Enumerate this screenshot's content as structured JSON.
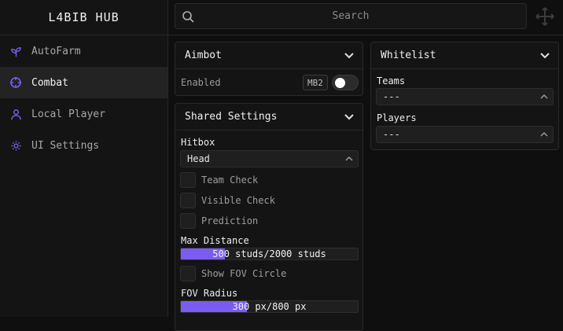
{
  "app": {
    "title": "L4BIB HUB"
  },
  "sidebar": {
    "items": [
      {
        "label": "AutoFarm",
        "icon": "sprout-icon"
      },
      {
        "label": "Combat",
        "icon": "crosshair-icon",
        "active": true
      },
      {
        "label": "Local Player",
        "icon": "user-icon"
      },
      {
        "label": "UI Settings",
        "icon": "gear-icon"
      }
    ]
  },
  "search": {
    "placeholder": "Search"
  },
  "aimbot": {
    "title": "Aimbot",
    "enabled_label": "Enabled",
    "keybind": "MB2",
    "enabled": false
  },
  "shared": {
    "title": "Shared Settings",
    "hitbox_label": "Hitbox",
    "hitbox_value": "Head",
    "team_check": "Team Check",
    "visible_check": "Visible Check",
    "prediction": "Prediction",
    "max_distance_label": "Max Distance",
    "max_distance_text": "500 studs/2000 studs",
    "max_distance_fraction": 0.25,
    "show_fov": "Show FOV Circle",
    "fov_radius_label": "FOV Radius",
    "fov_radius_text": "300 px/800 px",
    "fov_radius_fraction": 0.375
  },
  "whitelist": {
    "title": "Whitelist",
    "teams_label": "Teams",
    "teams_value": "---",
    "players_label": "Players",
    "players_value": "---"
  },
  "colors": {
    "accent": "#7b5cf0",
    "background": "#0f0f0f",
    "panel": "#141414"
  }
}
